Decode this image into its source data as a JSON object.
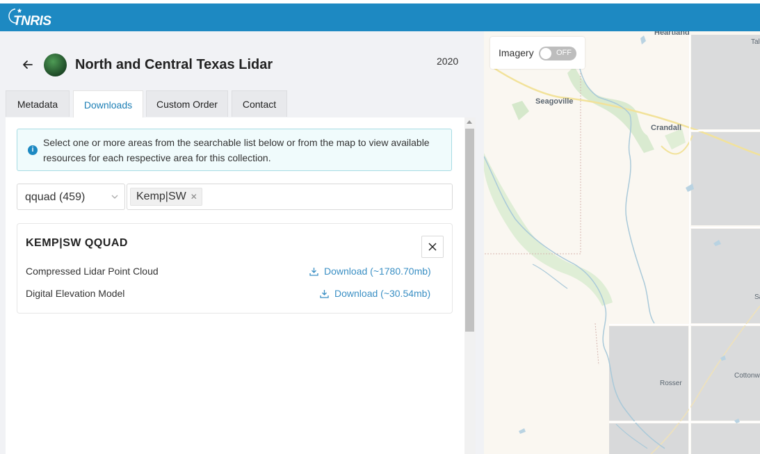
{
  "header": {
    "logo_text": "TNRIS",
    "brand_color": "#1d89c2"
  },
  "collection": {
    "title": "North and Central Texas Lidar",
    "year": "2020",
    "back_icon": "arrow-left-icon"
  },
  "tabs": [
    {
      "label": "Metadata",
      "active": false
    },
    {
      "label": "Downloads",
      "active": true
    },
    {
      "label": "Custom Order",
      "active": false
    },
    {
      "label": "Contact",
      "active": false
    }
  ],
  "info": {
    "text": "Select one or more areas from the searchable list below or from the map to view available resources for each respective area for this collection.",
    "icon": "info-icon"
  },
  "area_select": {
    "value": "qquad (459)"
  },
  "selected_areas": [
    "Kemp|SW"
  ],
  "area_card": {
    "title": "KEMP|SW QQUAD",
    "resources": [
      {
        "name": "Compressed Lidar Point Cloud",
        "link": "Download (~1780.70mb)"
      },
      {
        "name": "Digital Elevation Model",
        "link": "Download (~30.54mb)"
      }
    ]
  },
  "map": {
    "imagery_label": "Imagery",
    "imagery_toggle": "OFF",
    "places": [
      "Heartland",
      "Tal",
      "Seagoville",
      "Crandall",
      "Sa",
      "Rosser",
      "Cottonw"
    ]
  }
}
